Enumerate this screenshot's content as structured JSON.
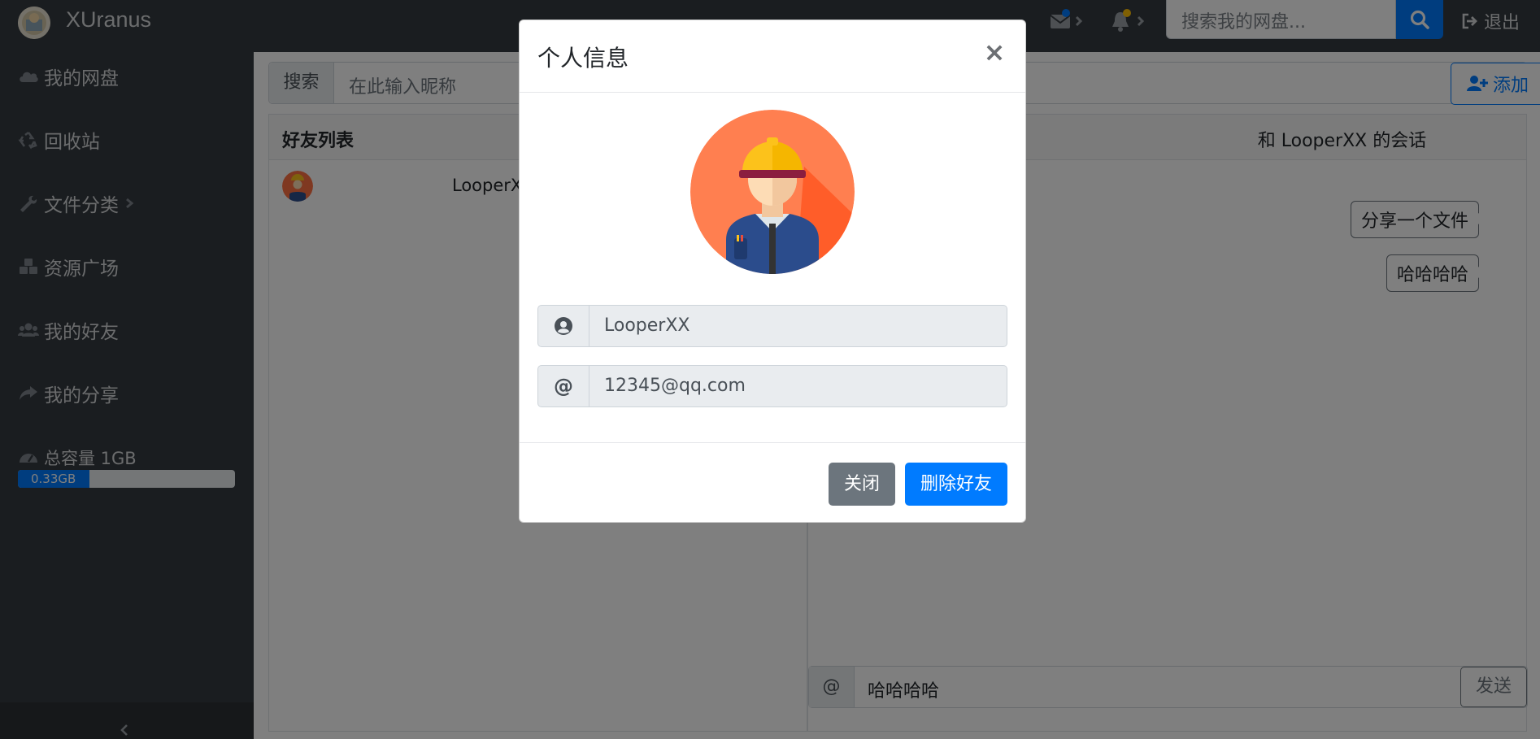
{
  "app": {
    "title": "XUranus"
  },
  "navbar": {
    "search_placeholder": "搜索我的网盘...",
    "logout_label": "退出",
    "mail_badge_color": "#007bff",
    "bell_badge_color": "#ffc107"
  },
  "sidebar": {
    "items": [
      {
        "label": "我的网盘",
        "icon": "cloud-icon"
      },
      {
        "label": "回收站",
        "icon": "recycle-icon"
      },
      {
        "label": "文件分类",
        "icon": "wrench-icon"
      },
      {
        "label": "资源广场",
        "icon": "cubes-icon"
      },
      {
        "label": "我的好友",
        "icon": "users-icon"
      },
      {
        "label": "我的分享",
        "icon": "share-icon"
      }
    ],
    "capacity": {
      "label": "总容量 1GB",
      "used_label": "0.33GB",
      "used_fraction": 0.33
    }
  },
  "main": {
    "search_addon": "搜索",
    "search_placeholder": "在此输入昵称",
    "add_button_label": "添加",
    "friend_list_title": "好友列表",
    "friends": [
      {
        "name": "LooperXX"
      }
    ],
    "chat": {
      "title": "和 LooperXX 的会话",
      "messages": [
        "分享一个文件",
        "哈哈哈哈"
      ],
      "input_addon": "@",
      "input_value": "哈哈哈哈",
      "send_label": "发送"
    }
  },
  "modal": {
    "title": "个人信息",
    "close_symbol": "×",
    "username": "LooperXX",
    "email_addon": "@",
    "email": "12345@qq.com",
    "close_button_label": "关闭",
    "delete_button_label": "删除好友"
  },
  "colors": {
    "primary": "#007bff",
    "secondary": "#6c757d",
    "sidebar_bg": "#343a40"
  }
}
